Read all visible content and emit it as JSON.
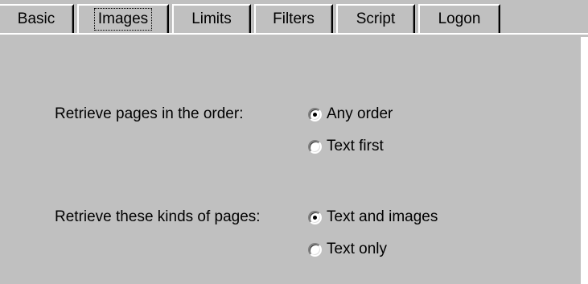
{
  "tabs": [
    {
      "label": "Basic",
      "selected": false
    },
    {
      "label": "Images",
      "selected": true
    },
    {
      "label": "Limits",
      "selected": false
    },
    {
      "label": "Filters",
      "selected": false
    },
    {
      "label": "Script",
      "selected": false
    },
    {
      "label": "Logon",
      "selected": false
    }
  ],
  "order": {
    "label": "Retrieve pages in the order:",
    "options": [
      {
        "label": "Any order",
        "checked": true
      },
      {
        "label": "Text first",
        "checked": false
      }
    ]
  },
  "kinds": {
    "label": "Retrieve these kinds of pages:",
    "options": [
      {
        "label": "Text and images",
        "checked": true
      },
      {
        "label": "Text only",
        "checked": false
      }
    ]
  },
  "colors": {
    "face": "#c0c0c0",
    "highlight": "#ffffff",
    "shadow": "#808080",
    "dark_shadow": "#000000"
  }
}
